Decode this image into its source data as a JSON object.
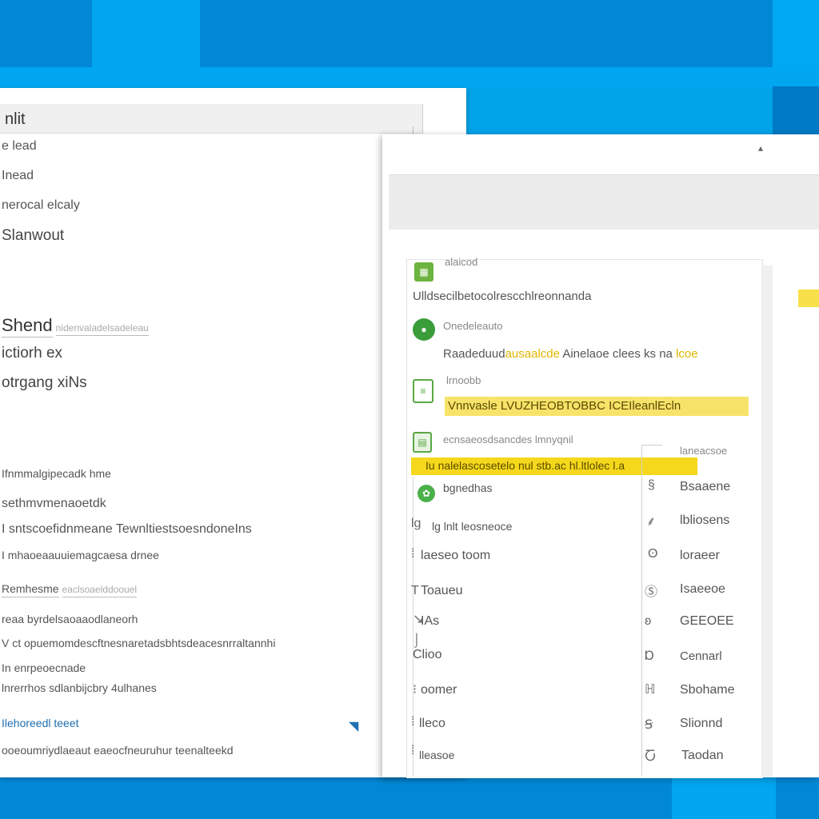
{
  "left_window": {
    "title": "nlit",
    "menu": [
      "e lead",
      "Inead",
      "nerocal elcaly",
      "Slanwout"
    ],
    "shared": {
      "title": "Shend",
      "title_suffix": "nidenvaladelsadeleau"
    },
    "sub_items": [
      "ictiorh ex",
      "otrgang xiNs"
    ],
    "details": [
      "Ifnmmalgipecadk hme",
      "sethmvmenaoetdk",
      "I sntscoefidnmeane TewnltiestsoesndoneIns",
      "I mhaoeaauuiemagcaesa drnee"
    ],
    "section2": {
      "label": "Remhesme",
      "suffix": "eaclsoaelddoouel"
    },
    "details2": [
      "reaa byrdelsaoaaodlaneorh",
      "V ct opuemomdescftnesnaretadsbhtsdeacesnrraltannhi",
      "In enrpeoecnade",
      "lnrerrhos sdlanbijcbry 4ulhanes"
    ],
    "link": "Ilehoreedl teeet",
    "footer": "ooeoumriydlaeaut eaeocfneuruhur teenalteekd"
  },
  "right_window": {
    "close_glyph": "▴",
    "panel": {
      "group1": {
        "icon_name": "sheet-app-icon",
        "header": "alaicod",
        "line": "Ulldsecilbetocolrescchlreonnanda"
      },
      "group2": {
        "icon_name": "circle-app-icon",
        "header": "Onedeleauto",
        "line": "Raadeduud",
        "line_hl": "ausaalcde",
        "line_rest": "Ainelaoe clees ks na",
        "line_end": "lcoe"
      },
      "group3": {
        "icon_name": "spreadsheet-icon",
        "header": "lrnoobb",
        "highlight": "Vnnvasle LVUZHEOBTOBBC ICEIleanlEcln"
      },
      "group4": {
        "icon_name": "grid-icon",
        "header": "ecnsaeosdsancdes lmnyqnil",
        "highlight": "Iu nalelascosetelo nul stb.ac hl.ltlolec l.a",
        "col_header": "laneacsoe"
      },
      "rows_left": [
        "bgnedhas",
        "lg lnlt leosneoce",
        "laeseo toom",
        "Toaueu",
        "IAs",
        "Clioo",
        "oomer",
        "lleco",
        "lleasoe"
      ],
      "rows_left_icons": [
        "gear-icon",
        "doc-icon",
        "list-icon",
        "text-icon",
        "pin-icon",
        "bar-icon",
        "dash-icon",
        "doc2-icon",
        "bracket-icon"
      ],
      "rows_right": [
        "Bsaaene",
        "lbliosens",
        "loraeer",
        "Isaeeoe",
        "GEEOEE",
        "Cennarl",
        "Sbohame",
        "Slionnd",
        "Taodan"
      ],
      "rows_right_glyphs": [
        "§",
        "⸙",
        "ʘ",
        "Ⓢ",
        "ʚ",
        "Ɒ",
        "ℍ",
        "Ꞩ",
        "Ⴀ"
      ]
    }
  },
  "colors": {
    "desktop_blue": "#00a2e8",
    "desktop_dark": "#0088d6",
    "highlight_yellow": "#f7e04a",
    "accent_green": "#6cb33f"
  }
}
